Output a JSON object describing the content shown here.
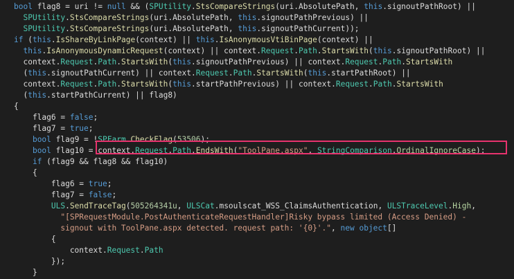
{
  "colors": {
    "background": "#1e1e1e",
    "keyword": "#569cd6",
    "type": "#4ec9b0",
    "method": "#dcdcaa",
    "default": "#dcdcdc",
    "string": "#d69d85",
    "number": "#b5cea8",
    "enum": "#b8d7a3",
    "highlight_border": "#e8336e"
  },
  "code": {
    "lines": [
      [
        [
          "kw",
          "bool"
        ],
        [
          "var",
          " flag8 = uri != "
        ],
        [
          "kw",
          "null"
        ],
        [
          "var",
          " && ("
        ],
        [
          "type",
          "SPUtility"
        ],
        [
          "var",
          "."
        ],
        [
          "method",
          "StsCompareStrings"
        ],
        [
          "var",
          "(uri."
        ],
        [
          "prop",
          "AbsolutePath"
        ],
        [
          "var",
          ", "
        ],
        [
          "kw",
          "this"
        ],
        [
          "var",
          "."
        ],
        [
          "prop",
          "signoutPathRoot"
        ],
        [
          "var",
          ") ||"
        ]
      ],
      [
        [
          "var",
          "  "
        ],
        [
          "type",
          "SPUtility"
        ],
        [
          "var",
          "."
        ],
        [
          "method",
          "StsCompareStrings"
        ],
        [
          "var",
          "(uri."
        ],
        [
          "prop",
          "AbsolutePath"
        ],
        [
          "var",
          ", "
        ],
        [
          "kw",
          "this"
        ],
        [
          "var",
          "."
        ],
        [
          "prop",
          "signoutPathPrevious"
        ],
        [
          "var",
          ") ||"
        ]
      ],
      [
        [
          "var",
          "  "
        ],
        [
          "type",
          "SPUtility"
        ],
        [
          "var",
          "."
        ],
        [
          "method",
          "StsCompareStrings"
        ],
        [
          "var",
          "(uri."
        ],
        [
          "prop",
          "AbsolutePath"
        ],
        [
          "var",
          ", "
        ],
        [
          "kw",
          "this"
        ],
        [
          "var",
          "."
        ],
        [
          "prop",
          "signoutPathCurrent"
        ],
        [
          "var",
          "));"
        ]
      ],
      [
        [
          "kw",
          "if"
        ],
        [
          "var",
          " ("
        ],
        [
          "kw",
          "this"
        ],
        [
          "var",
          "."
        ],
        [
          "method",
          "IsShareByLinkPage"
        ],
        [
          "var",
          "(context) || "
        ],
        [
          "kw",
          "this"
        ],
        [
          "var",
          "."
        ],
        [
          "method",
          "IsAnonymousVtiBinPage"
        ],
        [
          "var",
          "(context) ||"
        ]
      ],
      [
        [
          "var",
          "  "
        ],
        [
          "kw",
          "this"
        ],
        [
          "var",
          "."
        ],
        [
          "method",
          "IsAnonymousDynamicRequest"
        ],
        [
          "var",
          "(context) || context."
        ],
        [
          "type",
          "Request"
        ],
        [
          "var",
          "."
        ],
        [
          "type",
          "Path"
        ],
        [
          "var",
          "."
        ],
        [
          "method",
          "StartsWith"
        ],
        [
          "var",
          "("
        ],
        [
          "kw",
          "this"
        ],
        [
          "var",
          "."
        ],
        [
          "prop",
          "signoutPathRoot"
        ],
        [
          "var",
          ") ||"
        ]
      ],
      [
        [
          "var",
          "  context."
        ],
        [
          "type",
          "Request"
        ],
        [
          "var",
          "."
        ],
        [
          "type",
          "Path"
        ],
        [
          "var",
          "."
        ],
        [
          "method",
          "StartsWith"
        ],
        [
          "var",
          "("
        ],
        [
          "kw",
          "this"
        ],
        [
          "var",
          "."
        ],
        [
          "prop",
          "signoutPathPrevious"
        ],
        [
          "var",
          ") || context."
        ],
        [
          "type",
          "Request"
        ],
        [
          "var",
          "."
        ],
        [
          "type",
          "Path"
        ],
        [
          "var",
          "."
        ],
        [
          "method",
          "StartsWith"
        ]
      ],
      [
        [
          "var",
          "  ("
        ],
        [
          "kw",
          "this"
        ],
        [
          "var",
          "."
        ],
        [
          "prop",
          "signoutPathCurrent"
        ],
        [
          "var",
          ") || context."
        ],
        [
          "type",
          "Request"
        ],
        [
          "var",
          "."
        ],
        [
          "type",
          "Path"
        ],
        [
          "var",
          "."
        ],
        [
          "method",
          "StartsWith"
        ],
        [
          "var",
          "("
        ],
        [
          "kw",
          "this"
        ],
        [
          "var",
          "."
        ],
        [
          "prop",
          "startPathRoot"
        ],
        [
          "var",
          ") ||"
        ]
      ],
      [
        [
          "var",
          "  context."
        ],
        [
          "type",
          "Request"
        ],
        [
          "var",
          "."
        ],
        [
          "type",
          "Path"
        ],
        [
          "var",
          "."
        ],
        [
          "method",
          "StartsWith"
        ],
        [
          "var",
          "("
        ],
        [
          "kw",
          "this"
        ],
        [
          "var",
          "."
        ],
        [
          "prop",
          "startPathPrevious"
        ],
        [
          "var",
          ") || context."
        ],
        [
          "type",
          "Request"
        ],
        [
          "var",
          "."
        ],
        [
          "type",
          "Path"
        ],
        [
          "var",
          "."
        ],
        [
          "method",
          "StartsWith"
        ]
      ],
      [
        [
          "var",
          "  ("
        ],
        [
          "kw",
          "this"
        ],
        [
          "var",
          "."
        ],
        [
          "prop",
          "startPathCurrent"
        ],
        [
          "var",
          ") || flag8)"
        ]
      ],
      [
        [
          "var",
          "{"
        ]
      ],
      [
        [
          "var",
          "    flag6 = "
        ],
        [
          "kw",
          "false"
        ],
        [
          "var",
          ";"
        ]
      ],
      [
        [
          "var",
          "    flag7 = "
        ],
        [
          "kw",
          "true"
        ],
        [
          "var",
          ";"
        ]
      ],
      [
        [
          "var",
          "    "
        ],
        [
          "kw",
          "bool"
        ],
        [
          "var",
          " flag9 = !"
        ],
        [
          "type",
          "SPFarm"
        ],
        [
          "var",
          "."
        ],
        [
          "method",
          "CheckFlag"
        ],
        [
          "var",
          "("
        ],
        [
          "num",
          "53506"
        ],
        [
          "var",
          ");"
        ]
      ],
      [
        [
          "var",
          "    "
        ],
        [
          "kw",
          "bool"
        ],
        [
          "var",
          " flag10 = "
        ],
        [
          "var",
          "context."
        ],
        [
          "type",
          "Request"
        ],
        [
          "var",
          "."
        ],
        [
          "type",
          "Path"
        ],
        [
          "var",
          "."
        ],
        [
          "method",
          "EndsWith"
        ],
        [
          "var",
          "("
        ],
        [
          "str",
          "\"ToolPane.aspx\""
        ],
        [
          "var",
          ", "
        ],
        [
          "type",
          "StringComparison"
        ],
        [
          "var",
          "."
        ],
        [
          "enum",
          "OrdinalIgnoreCase"
        ],
        [
          "var",
          ");"
        ]
      ],
      [
        [
          "var",
          "    "
        ],
        [
          "kw",
          "if"
        ],
        [
          "var",
          " (flag9 && flag8 && flag10)"
        ]
      ],
      [
        [
          "var",
          "    {"
        ]
      ],
      [
        [
          "var",
          "        flag6 = "
        ],
        [
          "kw",
          "true"
        ],
        [
          "var",
          ";"
        ]
      ],
      [
        [
          "var",
          "        flag7 = "
        ],
        [
          "kw",
          "false"
        ],
        [
          "var",
          ";"
        ]
      ],
      [
        [
          "var",
          "        "
        ],
        [
          "type",
          "ULS"
        ],
        [
          "var",
          "."
        ],
        [
          "method",
          "SendTraceTag"
        ],
        [
          "var",
          "("
        ],
        [
          "num",
          "505264341u"
        ],
        [
          "var",
          ", "
        ],
        [
          "type",
          "ULSCat"
        ],
        [
          "var",
          "."
        ],
        [
          "prop",
          "msoulscat_WSS_ClaimsAuthentication"
        ],
        [
          "var",
          ", "
        ],
        [
          "type",
          "ULSTraceLevel"
        ],
        [
          "var",
          "."
        ],
        [
          "enum",
          "High"
        ],
        [
          "var",
          ","
        ]
      ],
      [
        [
          "var",
          "          "
        ],
        [
          "str",
          "\"[SPRequestModule.PostAuthenticateRequestHandler]Risky bypass limited (Access Denied) -"
        ]
      ],
      [
        [
          "str",
          "          signout with ToolPane.aspx detected. request path: '{0}'.\""
        ],
        [
          "var",
          ", "
        ],
        [
          "kw",
          "new"
        ],
        [
          "var",
          " "
        ],
        [
          "kw",
          "object"
        ],
        [
          "var",
          "[]"
        ]
      ],
      [
        [
          "var",
          "        {"
        ]
      ],
      [
        [
          "var",
          "            context."
        ],
        [
          "type",
          "Request"
        ],
        [
          "var",
          "."
        ],
        [
          "type",
          "Path"
        ]
      ],
      [
        [
          "var",
          "        });"
        ]
      ],
      [
        [
          "var",
          "    }"
        ]
      ],
      [
        [
          "var",
          "}"
        ]
      ]
    ]
  }
}
